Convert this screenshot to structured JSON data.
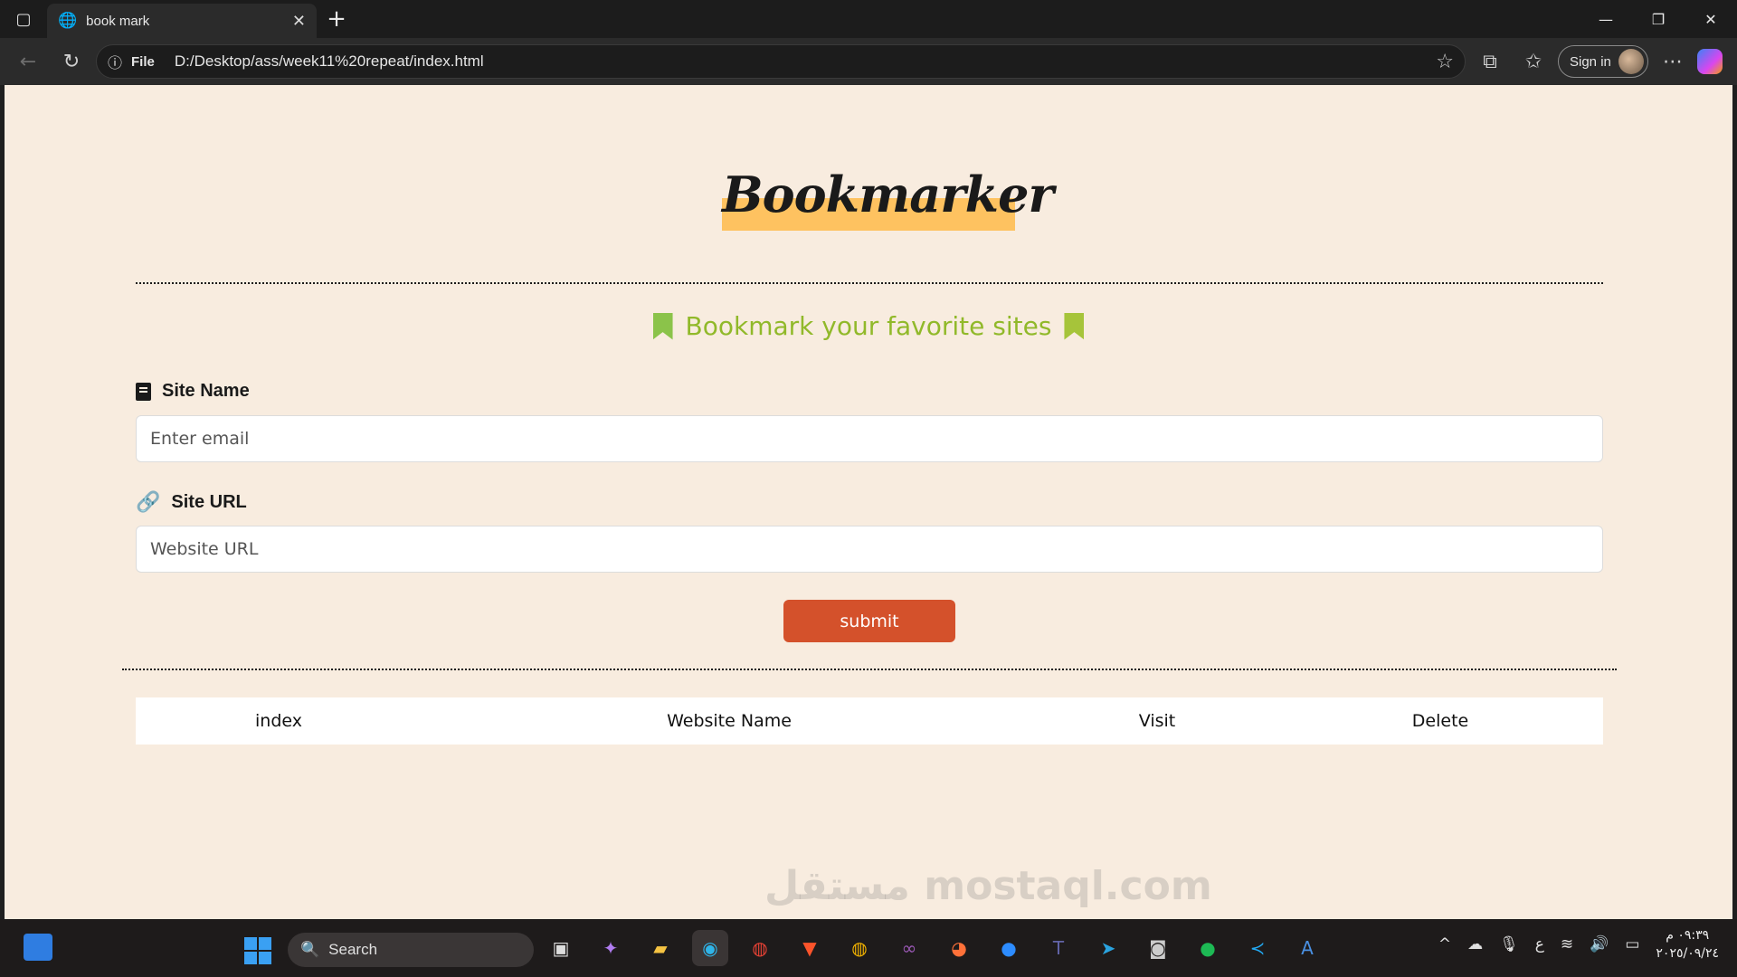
{
  "browser": {
    "tab_title": "book mark",
    "address_label": "File",
    "url": "D:/Desktop/ass/week11%20repeat/index.html",
    "signin_label": "Sign in"
  },
  "page": {
    "logo": "Bookmarker",
    "subtitle": "Bookmark your favorite sites",
    "site_name_label": "Site Name",
    "site_name_placeholder": "Enter email",
    "site_url_label": "Site URL",
    "site_url_placeholder": "Website URL",
    "submit_label": "submit",
    "table_headers": [
      "index",
      "Website Name",
      "Visit",
      "Delete"
    ]
  },
  "colors": {
    "page_bg": "#f8ecdf",
    "logo_highlight": "#fec260",
    "subtitle": "#91b92a",
    "submit_bg": "#d4512b"
  },
  "watermark": "مستقل mostaql.com",
  "taskbar": {
    "search_label": "Search",
    "clock_time": "٠٩:٣٩ م",
    "clock_date": "٢٠٢٥/٠٩/٢٤"
  }
}
